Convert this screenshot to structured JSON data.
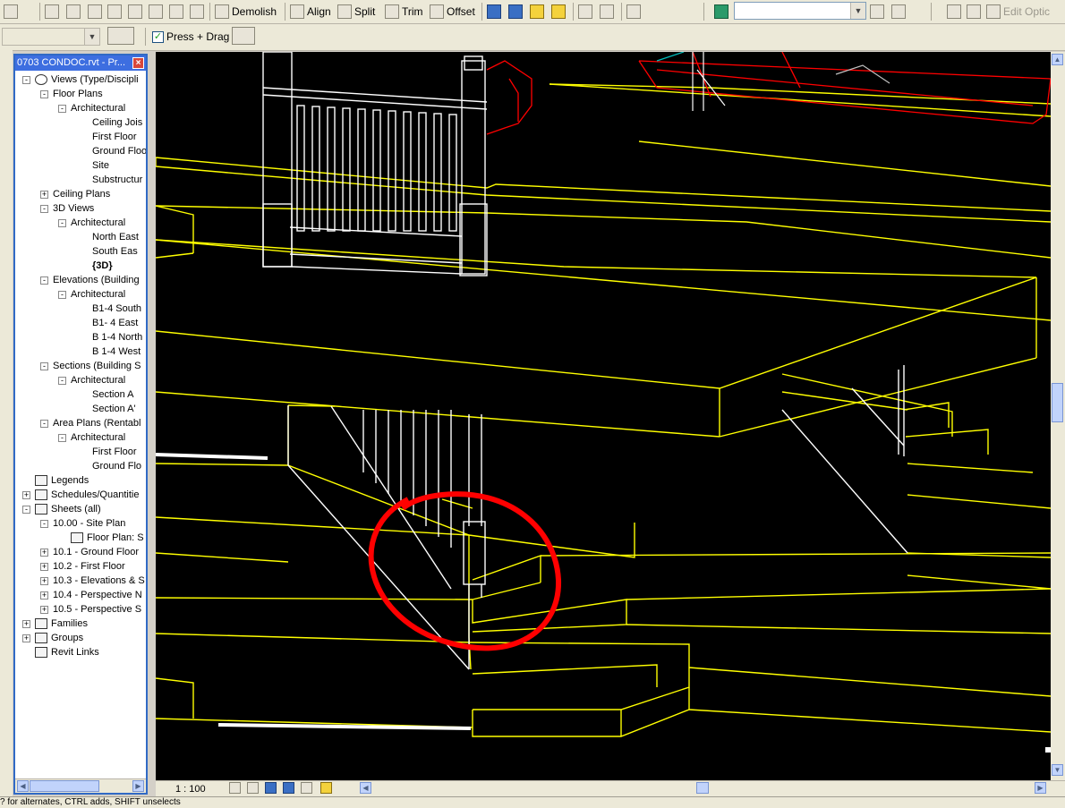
{
  "toolbar": {
    "demolish_label": "Demolish",
    "align_label": "Align",
    "split_label": "Split",
    "trim_label": "Trim",
    "offset_label": "Offset",
    "edit_options_label": "Edit Optic"
  },
  "options_bar": {
    "press_drag_label": "Press + Drag",
    "press_drag_checked": true
  },
  "browser": {
    "title": "0703 CONDOC.rvt - Pr...",
    "items": [
      {
        "label": "Views (Type/Discipli",
        "level": 0,
        "expander": "-",
        "icon": "eye"
      },
      {
        "label": "Floor Plans",
        "level": 1,
        "expander": "-"
      },
      {
        "label": "Architectural",
        "level": 2,
        "expander": "-"
      },
      {
        "label": "Ceiling Jois",
        "level": 3,
        "expander": ""
      },
      {
        "label": "First Floor",
        "level": 3,
        "expander": ""
      },
      {
        "label": "Ground Floo",
        "level": 3,
        "expander": ""
      },
      {
        "label": "Site",
        "level": 3,
        "expander": ""
      },
      {
        "label": "Substructur",
        "level": 3,
        "expander": ""
      },
      {
        "label": "Ceiling Plans",
        "level": 1,
        "expander": "+"
      },
      {
        "label": "3D Views",
        "level": 1,
        "expander": "-"
      },
      {
        "label": "Architectural",
        "level": 2,
        "expander": "-"
      },
      {
        "label": "North East",
        "level": 3,
        "expander": ""
      },
      {
        "label": "South Eas",
        "level": 3,
        "expander": ""
      },
      {
        "label": "{3D}",
        "level": 3,
        "expander": "",
        "bold": true
      },
      {
        "label": "Elevations (Building",
        "level": 1,
        "expander": "-"
      },
      {
        "label": "Architectural",
        "level": 2,
        "expander": "-"
      },
      {
        "label": "B1-4 South",
        "level": 3,
        "expander": ""
      },
      {
        "label": "B1- 4  East",
        "level": 3,
        "expander": ""
      },
      {
        "label": "B 1-4 North",
        "level": 3,
        "expander": ""
      },
      {
        "label": "B 1-4 West",
        "level": 3,
        "expander": ""
      },
      {
        "label": "Sections (Building S",
        "level": 1,
        "expander": "-"
      },
      {
        "label": "Architectural",
        "level": 2,
        "expander": "-"
      },
      {
        "label": "Section A",
        "level": 3,
        "expander": ""
      },
      {
        "label": "Section A'",
        "level": 3,
        "expander": ""
      },
      {
        "label": "Area Plans (Rentabl",
        "level": 1,
        "expander": "-"
      },
      {
        "label": "Architectural",
        "level": 2,
        "expander": "-"
      },
      {
        "label": "First Floor",
        "level": 3,
        "expander": ""
      },
      {
        "label": "Ground Flo",
        "level": 3,
        "expander": ""
      },
      {
        "label": "Legends",
        "level": 0,
        "expander": "",
        "icon": "legend"
      },
      {
        "label": "Schedules/Quantitie",
        "level": 0,
        "expander": "+",
        "icon": "schedule"
      },
      {
        "label": "Sheets (all)",
        "level": 0,
        "expander": "-",
        "icon": "sheet"
      },
      {
        "label": "10.00 - Site Plan",
        "level": 1,
        "expander": "-"
      },
      {
        "label": "Floor Plan: S",
        "level": 2,
        "expander": "",
        "icon": "view"
      },
      {
        "label": "10.1 - Ground Floor",
        "level": 1,
        "expander": "+"
      },
      {
        "label": "10.2 - First Floor",
        "level": 1,
        "expander": "+"
      },
      {
        "label": "10.3 - Elevations & S",
        "level": 1,
        "expander": "+"
      },
      {
        "label": "10.4 - Perspective N",
        "level": 1,
        "expander": "+"
      },
      {
        "label": "10.5 - Perspective S",
        "level": 1,
        "expander": "+"
      },
      {
        "label": "Families",
        "level": 0,
        "expander": "+",
        "icon": "families"
      },
      {
        "label": "Groups",
        "level": 0,
        "expander": "+",
        "icon": "groups"
      },
      {
        "label": "Revit Links",
        "level": 0,
        "expander": "",
        "icon": "links"
      }
    ]
  },
  "view_control_bar": {
    "scale": "1 : 100"
  },
  "status_bar": {
    "text": "? for alternates, CTRL adds, SHIFT unselects"
  },
  "colors": {
    "model_lines": "#ffff00",
    "railing_lines": "#ffffff",
    "furniture_lines": "#ff0000",
    "annotation_circle": "#ff0000",
    "viewport_bg": "#000000"
  }
}
